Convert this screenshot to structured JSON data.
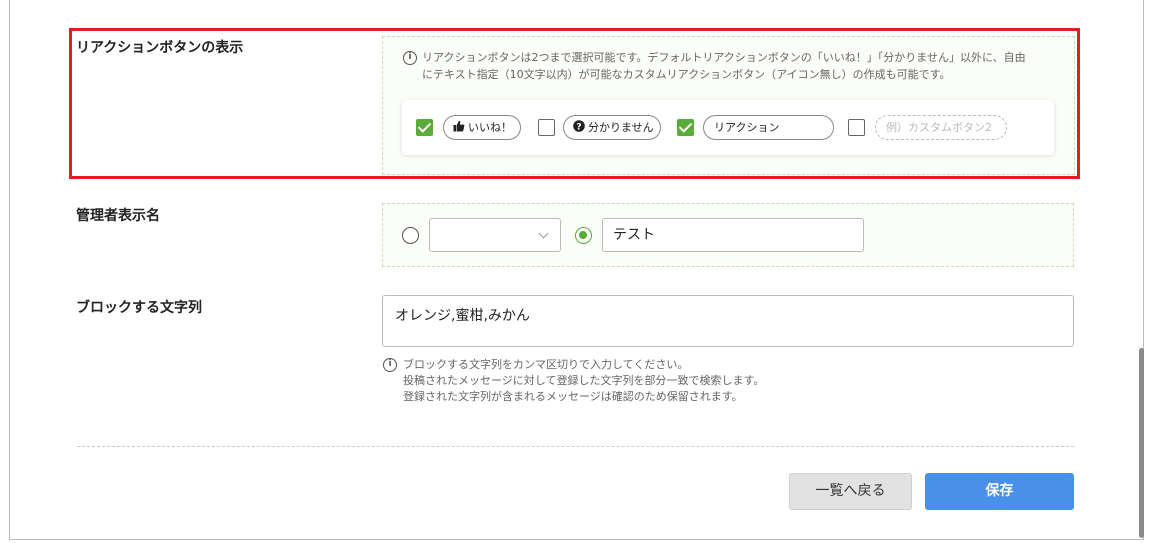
{
  "reaction": {
    "label": "リアクションボタンの表示",
    "info_line1": "リアクションボタンは2つまで選択可能です。デフォルトリアクションボタンの「いいね！」「分かりません」以外に、自由",
    "info_line2": "にテキスト指定（10文字以内）が可能なカスタムリアクションボタン（アイコン無し）の作成も可能です。",
    "buttons": [
      {
        "label": "いいね！",
        "checked": true,
        "icon": "thumbs-up-icon"
      },
      {
        "label": "分かりません",
        "checked": false,
        "icon": "question-circle-icon"
      },
      {
        "value": "リアクション",
        "checked": true
      },
      {
        "placeholder": "例）カスタムボタン2",
        "checked": false
      }
    ]
  },
  "admin_name": {
    "label": "管理者表示名",
    "select_value": "",
    "text_value": "テスト"
  },
  "block_words": {
    "label": "ブロックする文字列",
    "value": "オレンジ,蜜柑,みかん",
    "help_line1": "ブロックする文字列をカンマ区切りで入力してください。",
    "help_line2": "投稿されたメッセージに対して登録した文字列を部分一致で検索します。",
    "help_line3": "登録された文字列が含まれるメッセージは確認のため保留されます。"
  },
  "actions": {
    "back_label": "一覧へ戻る",
    "save_label": "保存"
  },
  "colors": {
    "highlight": "#e02020",
    "check_green": "#5aac3a",
    "save_blue": "#4a90e8"
  }
}
